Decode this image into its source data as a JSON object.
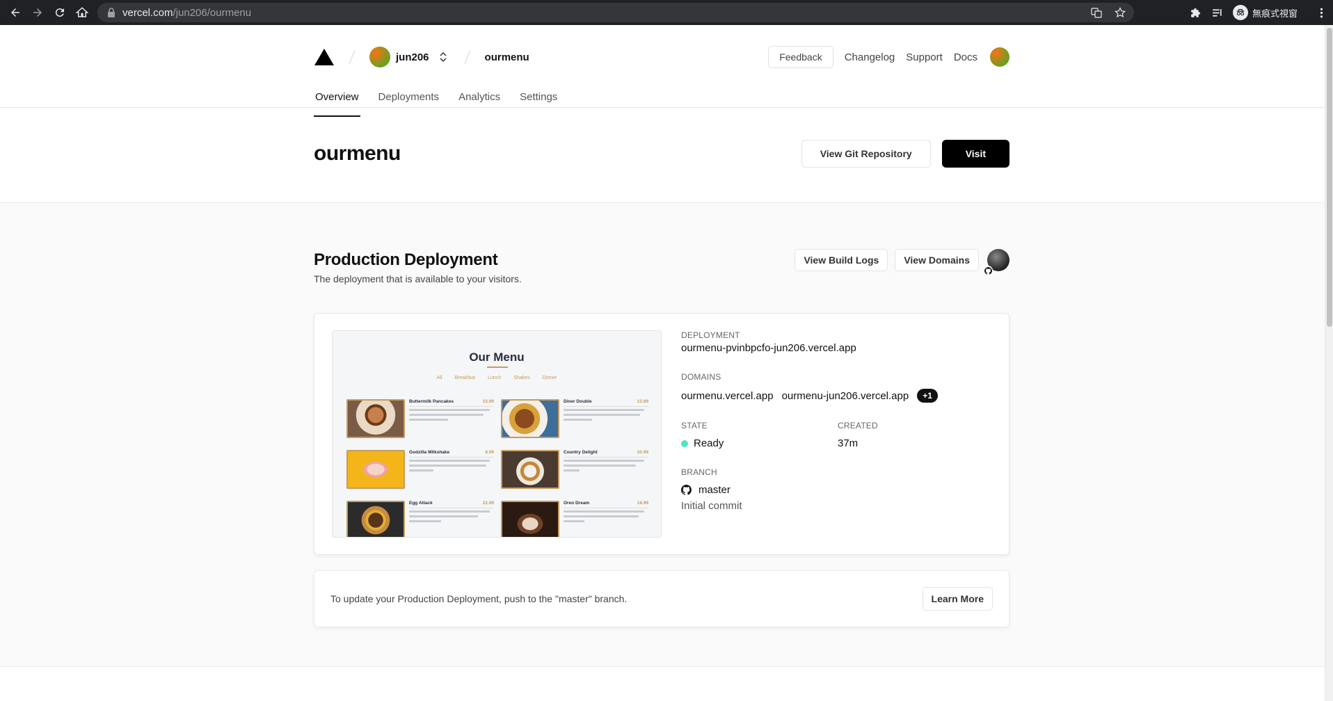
{
  "browser": {
    "url_host": "vercel.com",
    "url_path": "/jun206/ourmenu",
    "profile_label": "無痕式視窗"
  },
  "header": {
    "team": "jun206",
    "project": "ourmenu",
    "feedback_label": "Feedback",
    "links": [
      "Changelog",
      "Support",
      "Docs"
    ]
  },
  "tabs": [
    {
      "label": "Overview",
      "active": true
    },
    {
      "label": "Deployments",
      "active": false
    },
    {
      "label": "Analytics",
      "active": false
    },
    {
      "label": "Settings",
      "active": false
    }
  ],
  "project": {
    "title": "ourmenu",
    "git_button": "View Git Repository",
    "visit_button": "Visit"
  },
  "production": {
    "title": "Production Deployment",
    "subtitle": "The deployment that is available to your visitors.",
    "build_logs_button": "View Build Logs",
    "domains_button": "View Domains",
    "deployment_label": "DEPLOYMENT",
    "deployment_url": "ourmenu-pvinbpcfo-jun206.vercel.app",
    "domains_label": "DOMAINS",
    "domains": [
      "ourmenu.vercel.app",
      "ourmenu-jun206.vercel.app"
    ],
    "domains_more": "+1",
    "state_label": "STATE",
    "state_value": "Ready",
    "created_label": "CREATED",
    "created_value": "37m",
    "branch_label": "BRANCH",
    "branch_value": "master",
    "commit_message": "Initial commit"
  },
  "preview": {
    "title": "Our Menu",
    "categories": [
      "All",
      "Breakfast",
      "Lunch",
      "Shakes",
      "Dinner"
    ],
    "items": [
      {
        "name": "Buttermilk Pancakes",
        "price": "15.99"
      },
      {
        "name": "Diner Double",
        "price": "13.99"
      },
      {
        "name": "Godzilla Milkshake",
        "price": "6.99"
      },
      {
        "name": "Country Delight",
        "price": "20.99"
      },
      {
        "name": "Egg Attack",
        "price": "22.99"
      },
      {
        "name": "Oreo Dream",
        "price": "18.99"
      }
    ]
  },
  "banner": {
    "text": "To update your Production Deployment, push to the \"master\" branch.",
    "button": "Learn More"
  },
  "colors": {
    "ready_dot": "#50e3c2",
    "preview_accent": "#c59d5f"
  }
}
